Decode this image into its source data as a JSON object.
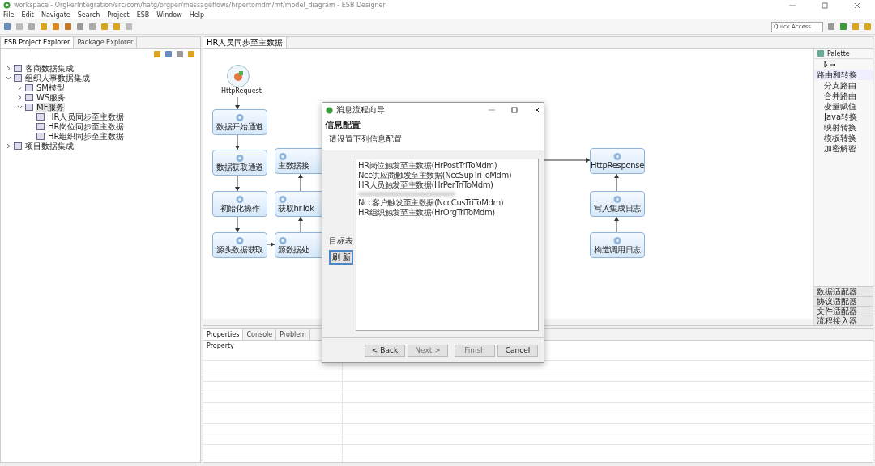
{
  "window": {
    "title": "workspace - OrgPerIntegration/src/com/hatg/orgper/messageflows/hrpertomdm/mf/model_diagram - ESB Designer"
  },
  "menu": [
    "File",
    "Edit",
    "Navigate",
    "Search",
    "Project",
    "ESB",
    "Window",
    "Help"
  ],
  "quick_access": {
    "placeholder": "Quick Access"
  },
  "explorer": {
    "tabs": [
      {
        "label": "ESB Project Explorer",
        "selected": true
      },
      {
        "label": "Package Explorer",
        "selected": false
      }
    ],
    "tree": [
      {
        "label": "客商数据集成",
        "expanded": false,
        "selected": false
      },
      {
        "label": "组织人事数据集成",
        "expanded": true,
        "selected": false,
        "children": [
          {
            "label": "SM模型",
            "expanded": false,
            "selected": false
          },
          {
            "label": "WS服务",
            "expanded": false,
            "selected": false
          },
          {
            "label": "MF服务",
            "expanded": true,
            "selected": true,
            "children": [
              {
                "label": "HR人员同步至主数据",
                "selected": false
              },
              {
                "label": "HR岗位同步至主数据",
                "selected": false
              },
              {
                "label": "HR组织同步至主数据",
                "selected": false
              }
            ]
          }
        ]
      },
      {
        "label": "项目数据集成",
        "expanded": false,
        "selected": false
      }
    ]
  },
  "editor": {
    "tab": "HR人员同步至主数据",
    "nodes": [
      {
        "kind": "start",
        "label": "HttpRequest"
      },
      {
        "kind": "step",
        "label": "数据开始通道"
      },
      {
        "kind": "step",
        "label": "数据获取通道"
      },
      {
        "kind": "step",
        "label": "初始化操作"
      },
      {
        "kind": "step",
        "label": "源头数据获取"
      },
      {
        "kind": "step",
        "label": "主数据接"
      },
      {
        "kind": "step",
        "label": "获取hrTok"
      },
      {
        "kind": "step",
        "label": "源数据处"
      },
      {
        "kind": "step",
        "label": "HttpResponse"
      },
      {
        "kind": "step",
        "label": "写入集成日志"
      },
      {
        "kind": "step",
        "label": "构造调用日志"
      }
    ]
  },
  "palette": {
    "title": "Palette",
    "group": "路由和转换",
    "items": [
      "分支路由",
      "合并路由",
      "变量赋值",
      "Java转换",
      "映射转换",
      "模板转换",
      "加密解密"
    ],
    "drawers": [
      "数据适配器",
      "协议适配器",
      "文件适配器",
      "流程接入器"
    ]
  },
  "bottom": {
    "tabs": [
      {
        "label": "Properties",
        "selected": true
      },
      {
        "label": "Console",
        "selected": false
      },
      {
        "label": "Problem",
        "selected": false
      }
    ],
    "column": "Property"
  },
  "dialog": {
    "title": "消息流程向导",
    "heading": "信息配置",
    "subtitle": "请设置下列信息配置",
    "label": "目标表",
    "refresh": "刷 新",
    "items": [
      {
        "kind": "text",
        "label": "HR岗位触发至主数据(HrPostTriToMdm)"
      },
      {
        "kind": "text",
        "label": "Ncc供应商触发至主数据(NccSupTriToMdm)"
      },
      {
        "kind": "text",
        "label": "HR人员触发至主数据(HrPerTriToMdm)"
      },
      {
        "kind": "redacted"
      },
      {
        "kind": "text",
        "label": "Ncc客户触发至主数据(NccCusTriToMdm)"
      },
      {
        "kind": "text",
        "label": "HR组织触发至主数据(HrOrgTriToMdm)"
      }
    ],
    "buttons": [
      {
        "label": "< Back",
        "disabled": false
      },
      {
        "label": "Next >",
        "disabled": true
      },
      {
        "label": "Finish",
        "disabled": true
      },
      {
        "label": "Cancel",
        "disabled": false
      }
    ]
  }
}
